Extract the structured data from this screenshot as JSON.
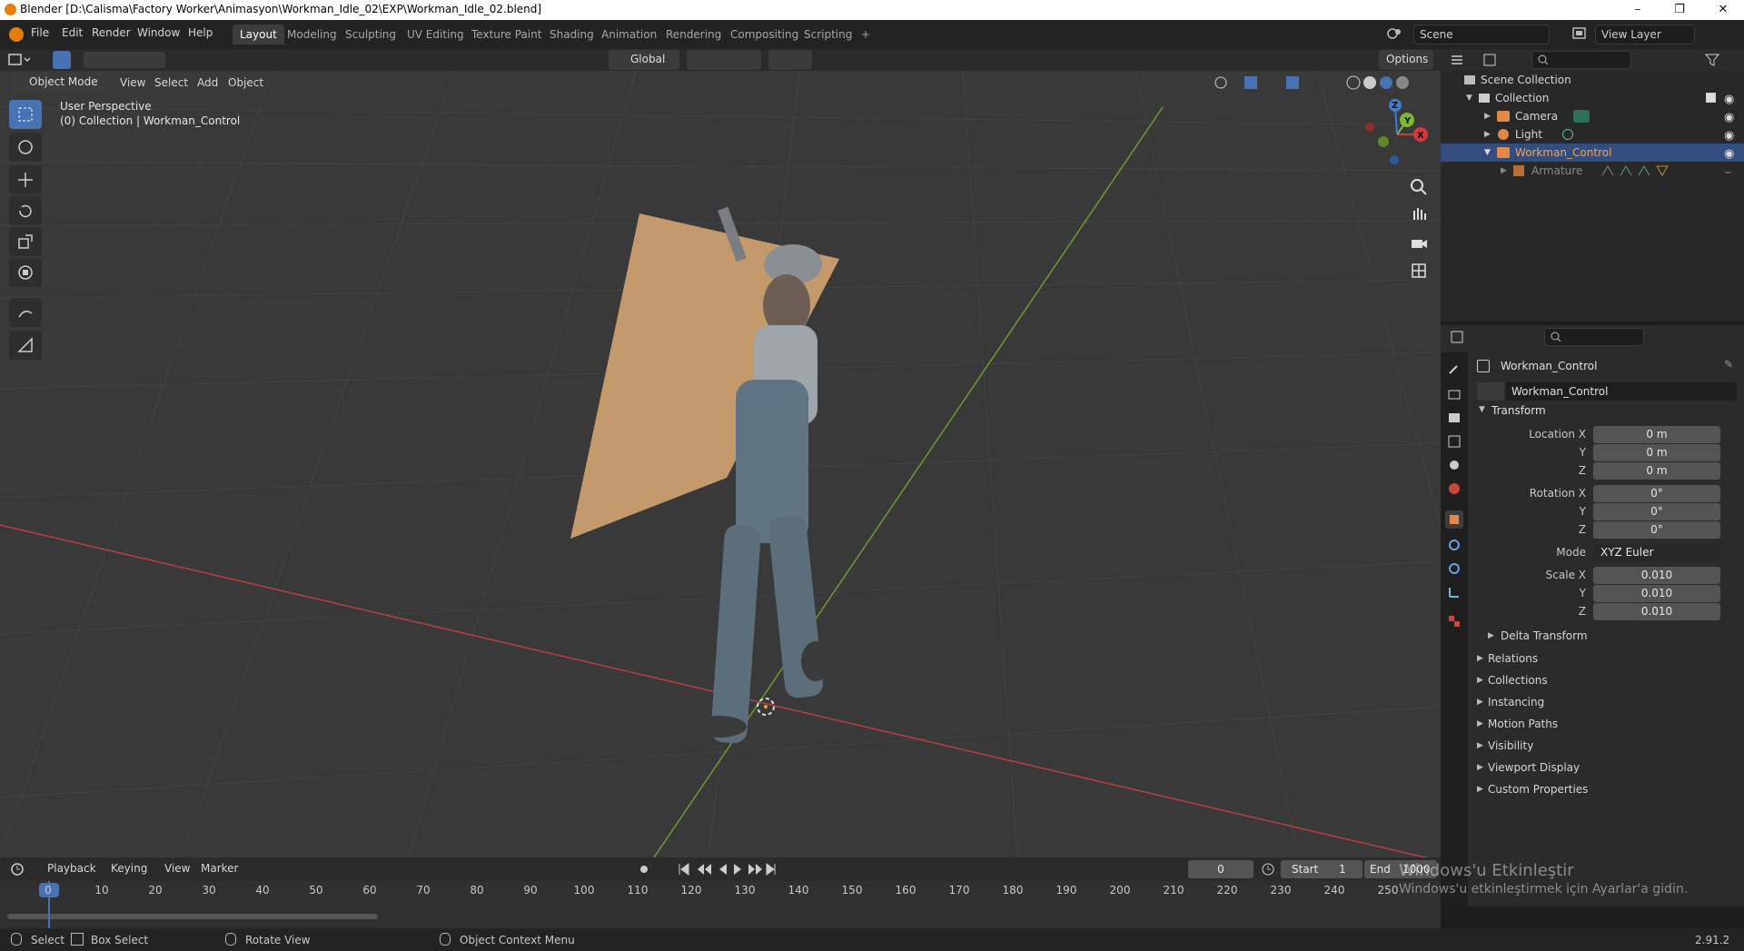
{
  "window": {
    "title": "Blender [D:\\Calisma\\Factory Worker\\Animasyon\\Workman_Idle_02\\EXP\\Workman_Idle_02.blend]",
    "minimize": "–",
    "maximize": "❐",
    "close": "✕"
  },
  "menu": [
    "File",
    "Edit",
    "Render",
    "Window",
    "Help"
  ],
  "workspaces": [
    "Layout",
    "Modeling",
    "Sculpting",
    "UV Editing",
    "Texture Paint",
    "Shading",
    "Animation",
    "Rendering",
    "Compositing",
    "Scripting",
    "+"
  ],
  "scene": {
    "name": "Scene",
    "view_layer": "View Layer"
  },
  "viewport": {
    "mode": "Object Mode",
    "menus": [
      "View",
      "Select",
      "Add",
      "Object"
    ],
    "transform_orientation": "Global",
    "options": "Options",
    "overlay_text_1": "User Perspective",
    "overlay_text_2": "(0) Collection | Workman_Control",
    "gizmo": {
      "x": "X",
      "y": "Y",
      "z": "Z"
    }
  },
  "outliner": {
    "search_placeholder": "",
    "rows": [
      {
        "label": "Scene Collection"
      },
      {
        "label": "Collection"
      },
      {
        "label": "Camera"
      },
      {
        "label": "Light"
      },
      {
        "label": "Workman_Control"
      },
      {
        "label": "Armature"
      }
    ]
  },
  "properties": {
    "object_name": "Workman_Control",
    "object_field": "Workman_Control",
    "transform_title": "Transform",
    "location": {
      "label_x": "Location X",
      "label_y": "Y",
      "label_z": "Z",
      "x": "0 m",
      "y": "0 m",
      "z": "0 m"
    },
    "rotation": {
      "label_x": "Rotation X",
      "label_y": "Y",
      "label_z": "Z",
      "x": "0°",
      "y": "0°",
      "z": "0°"
    },
    "mode_label": "Mode",
    "mode_value": "XYZ Euler",
    "scale": {
      "label_x": "Scale X",
      "label_y": "Y",
      "label_z": "Z",
      "x": "0.010",
      "y": "0.010",
      "z": "0.010"
    },
    "delta_transform": "Delta Transform",
    "panels": [
      "Relations",
      "Collections",
      "Instancing",
      "Motion Paths",
      "Visibility",
      "Viewport Display",
      "Custom Properties"
    ]
  },
  "timeline": {
    "menus": [
      "Playback",
      "Keying",
      "View",
      "Marker"
    ],
    "current_frame": "0",
    "start_label": "Start",
    "start_value": "1",
    "end_label": "End",
    "end_value": "1000",
    "ticks": [
      "0",
      "10",
      "20",
      "30",
      "40",
      "50",
      "60",
      "70",
      "80",
      "90",
      "100",
      "110",
      "120",
      "130",
      "140",
      "150",
      "160",
      "170",
      "180",
      "190",
      "200",
      "210",
      "220",
      "230",
      "240",
      "250"
    ]
  },
  "activation": {
    "line1": "Windows'u Etkinleştir",
    "line2": "Windows'u etkinleştirmek için Ayarlar'a gidin."
  },
  "statusbar": {
    "select": "Select",
    "box_select": "Box Select",
    "rotate_view": "Rotate View",
    "context_menu": "Object Context Menu",
    "version": "2.91.2"
  },
  "colors": {
    "accent": "#4772b3",
    "x_axis": "#d23a3a",
    "y_axis": "#7fb936",
    "z_axis": "#3d7fd6",
    "board": "#c49a6c"
  }
}
